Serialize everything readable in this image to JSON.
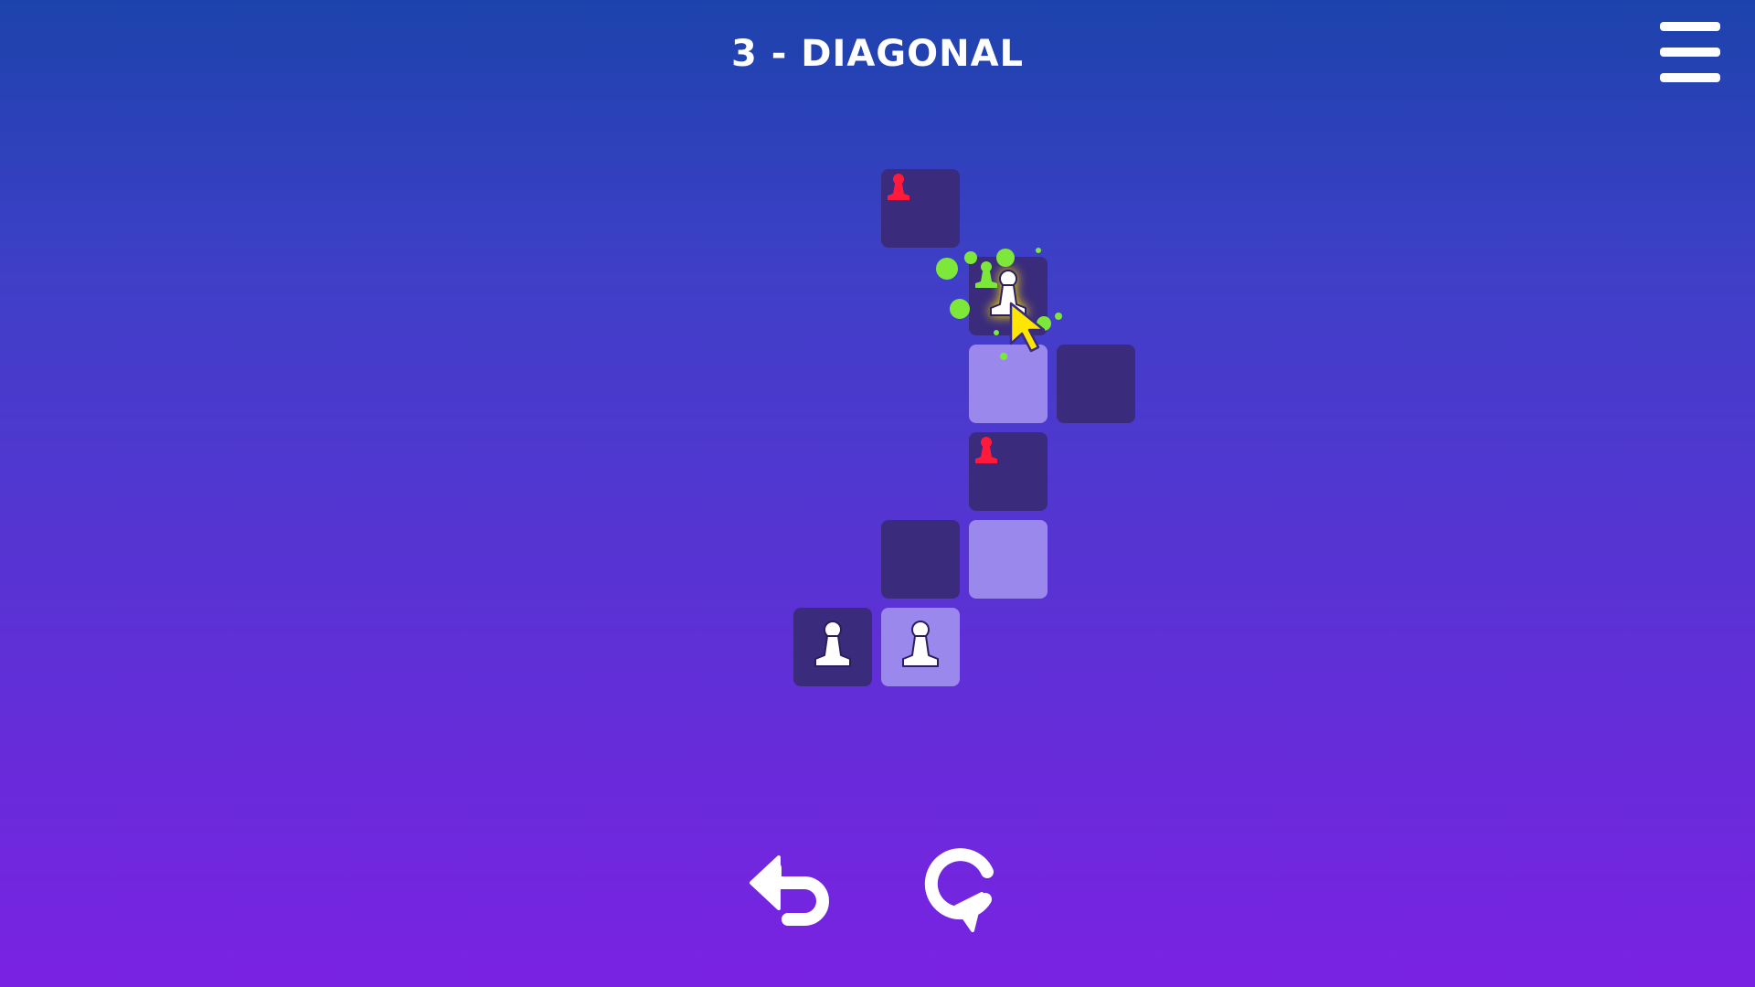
{
  "level": {
    "title": "3 - DIAGONAL"
  },
  "header": {
    "menu_icon": "hamburger-menu-icon"
  },
  "board": {
    "tiles": [
      {
        "id": "r0c1",
        "row": 0,
        "col": 1,
        "shade": "dark",
        "piece": "enemy-pawn-small"
      },
      {
        "id": "r1c2",
        "row": 1,
        "col": 2,
        "shade": "dark",
        "piece": "player-pawn-selected"
      },
      {
        "id": "r2c2",
        "row": 2,
        "col": 2,
        "shade": "light",
        "piece": ""
      },
      {
        "id": "r2c3",
        "row": 2,
        "col": 3,
        "shade": "dark",
        "piece": ""
      },
      {
        "id": "r3c2",
        "row": 3,
        "col": 2,
        "shade": "dark",
        "piece": "enemy-pawn-small"
      },
      {
        "id": "r4c1",
        "row": 4,
        "col": 1,
        "shade": "dark",
        "piece": ""
      },
      {
        "id": "r4c2",
        "row": 4,
        "col": 2,
        "shade": "light",
        "piece": ""
      },
      {
        "id": "r5c0",
        "row": 5,
        "col": 0,
        "shade": "dark",
        "piece": "player-pawn"
      },
      {
        "id": "r5c1",
        "row": 5,
        "col": 1,
        "shade": "light",
        "piece": "player-pawn"
      }
    ]
  },
  "controls": {
    "undo_icon": "undo-arrow-icon",
    "restart_icon": "restart-icon"
  },
  "colors": {
    "tile_dark": "#3a2b7c",
    "tile_light": "#9b88ec",
    "enemy": "#ff1a3c",
    "player": "#ffffff",
    "splash": "#7ee83a",
    "cursor": "#ffe600"
  }
}
